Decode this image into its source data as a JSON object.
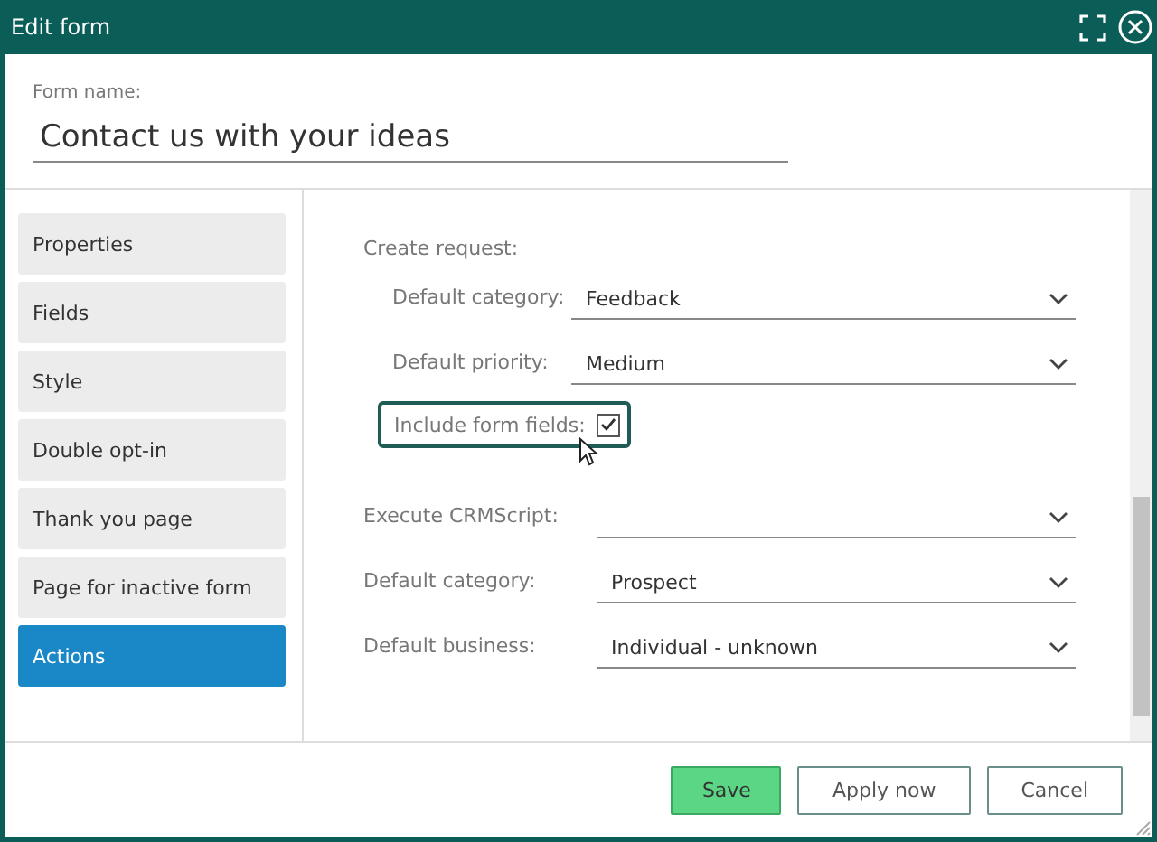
{
  "window": {
    "title": "Edit form"
  },
  "form_name": {
    "label": "Form name:",
    "value": "Contact us with your ideas"
  },
  "sidebar": {
    "items": [
      {
        "label": "Properties",
        "selected": false
      },
      {
        "label": "Fields",
        "selected": false
      },
      {
        "label": "Style",
        "selected": false
      },
      {
        "label": "Double opt-in",
        "selected": false
      },
      {
        "label": "Thank you page",
        "selected": false
      },
      {
        "label": "Page for inactive form",
        "selected": false
      },
      {
        "label": "Actions",
        "selected": true
      }
    ]
  },
  "actions": {
    "section_label": "Create request:",
    "request_fields": [
      {
        "label": "Default category:",
        "value": "Feedback"
      },
      {
        "label": "Default priority:",
        "value": "Medium"
      }
    ],
    "include_form_fields": {
      "label": "Include form fields:",
      "checked": true,
      "focused": true
    },
    "fields": [
      {
        "label": "Execute CRMScript:"
      },
      {
        "label": "Default category:",
        "value": "Prospect"
      },
      {
        "label": "Default business:",
        "value": "Individual - unknown"
      }
    ]
  },
  "buttons": [
    {
      "label": "Save",
      "kind": "primary"
    },
    {
      "label": "Apply now",
      "kind": "secondary"
    },
    {
      "label": "Cancel",
      "kind": "secondary"
    }
  ]
}
